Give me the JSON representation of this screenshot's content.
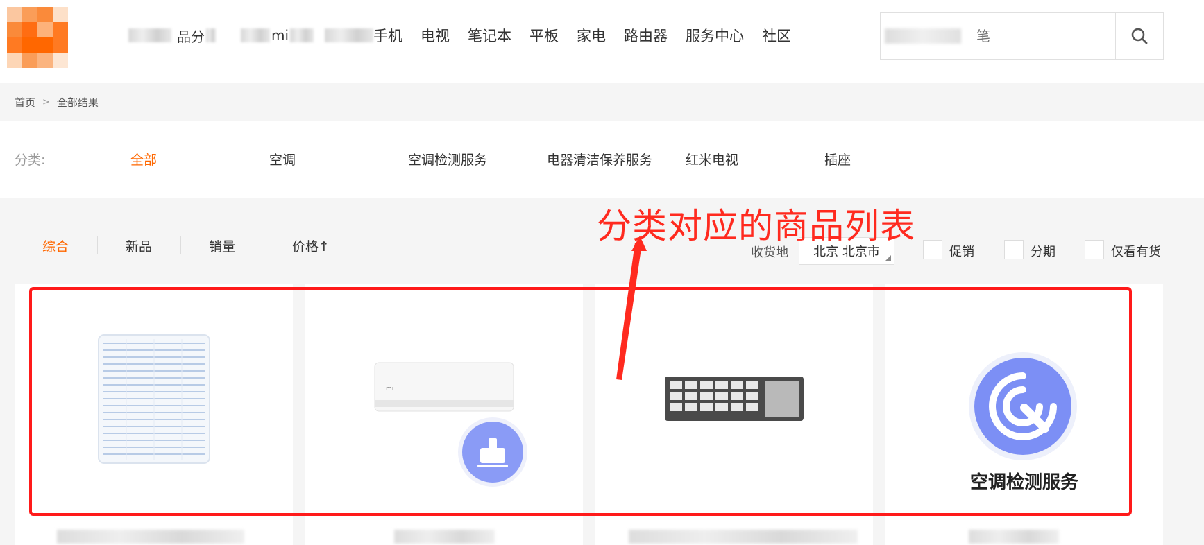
{
  "header": {
    "nav_items": [
      "手机",
      "电视",
      "笔记本",
      "平板",
      "家电",
      "路由器",
      "服务中心",
      "社区"
    ],
    "nav_partial_1": "品分",
    "nav_partial_2": "mi",
    "search": {
      "placeholder": "笔",
      "button_icon": "search-icon"
    }
  },
  "breadcrumb": {
    "home": "首页",
    "separator": ">",
    "current": "全部结果"
  },
  "categories": {
    "label": "分类:",
    "items": [
      "全部",
      "空调",
      "空调检测服务",
      "电器清洁保养服务",
      "红米电视",
      "插座"
    ],
    "active_index": 0
  },
  "sort": {
    "items": [
      "综合",
      "新品",
      "销量",
      "价格↑"
    ],
    "active_index": 0
  },
  "filters": {
    "ship_label": "收货地",
    "ship_value": "北京 北京市",
    "checkboxes": [
      "促销",
      "分期",
      "仅看有货"
    ]
  },
  "annotation": {
    "text": "分类对应的商品列表"
  },
  "products": [
    {
      "type": "filter-image"
    },
    {
      "type": "aircon-cleaning-image"
    },
    {
      "type": "aircon-part-image"
    },
    {
      "type": "service-image",
      "caption": "空调检测服务"
    }
  ],
  "colors": {
    "accent": "#ff6700",
    "annotation": "#ff2a1f",
    "service_blue": "#7c8ff5"
  }
}
